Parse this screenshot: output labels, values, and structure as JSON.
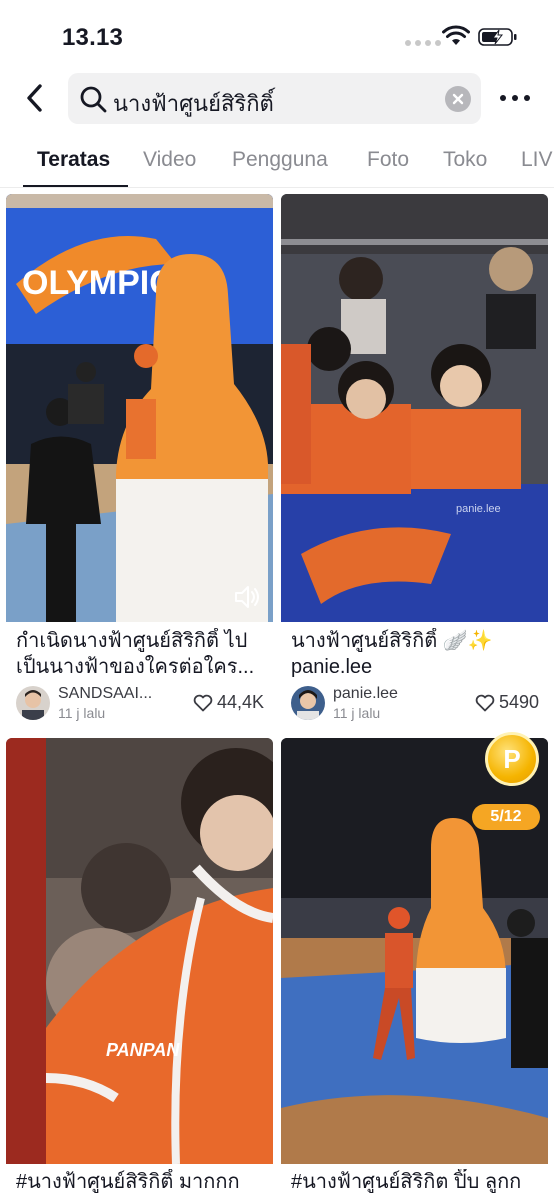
{
  "status_bar": {
    "time": "13.13"
  },
  "search": {
    "query": "นางฟ้าศูนย์สิริกิติ์"
  },
  "tabs": [
    {
      "label": "Teratas",
      "active": true
    },
    {
      "label": "Video",
      "active": false
    },
    {
      "label": "Pengguna",
      "active": false
    },
    {
      "label": "Foto",
      "active": false
    },
    {
      "label": "Toko",
      "active": false
    },
    {
      "label": "LIV",
      "active": false
    }
  ],
  "results": [
    {
      "caption": "กำเนิดนางฟ้าศูนย์สิริกิติ์ ไปเป็นนางฟ้าของใครต่อใคร...",
      "author": "SANDSAAI...",
      "time": "11 j lalu",
      "likes": "44,4K",
      "thumb_text": "OLYMPIC"
    },
    {
      "caption": "นางฟ้าศูนย์สิริกิติ์ 🪽✨ panie.lee",
      "author": "panie.lee",
      "time": "11 j lalu",
      "likes": "5490",
      "thumb_text": "panie.lee"
    },
    {
      "caption": "#นางฟ้าศูนย์สิริกิติ์ มากกก",
      "thumb_text": "PANPAN"
    },
    {
      "caption": "#นางฟ้าศูนย์สิริกิต ปิ๊บ ลูกก"
    }
  ],
  "reward": {
    "coin_label": "P",
    "progress": "5/12"
  },
  "colors": {
    "accent_orange": "#f5a623",
    "text_primary": "#161823",
    "text_secondary": "#8a8b91"
  }
}
